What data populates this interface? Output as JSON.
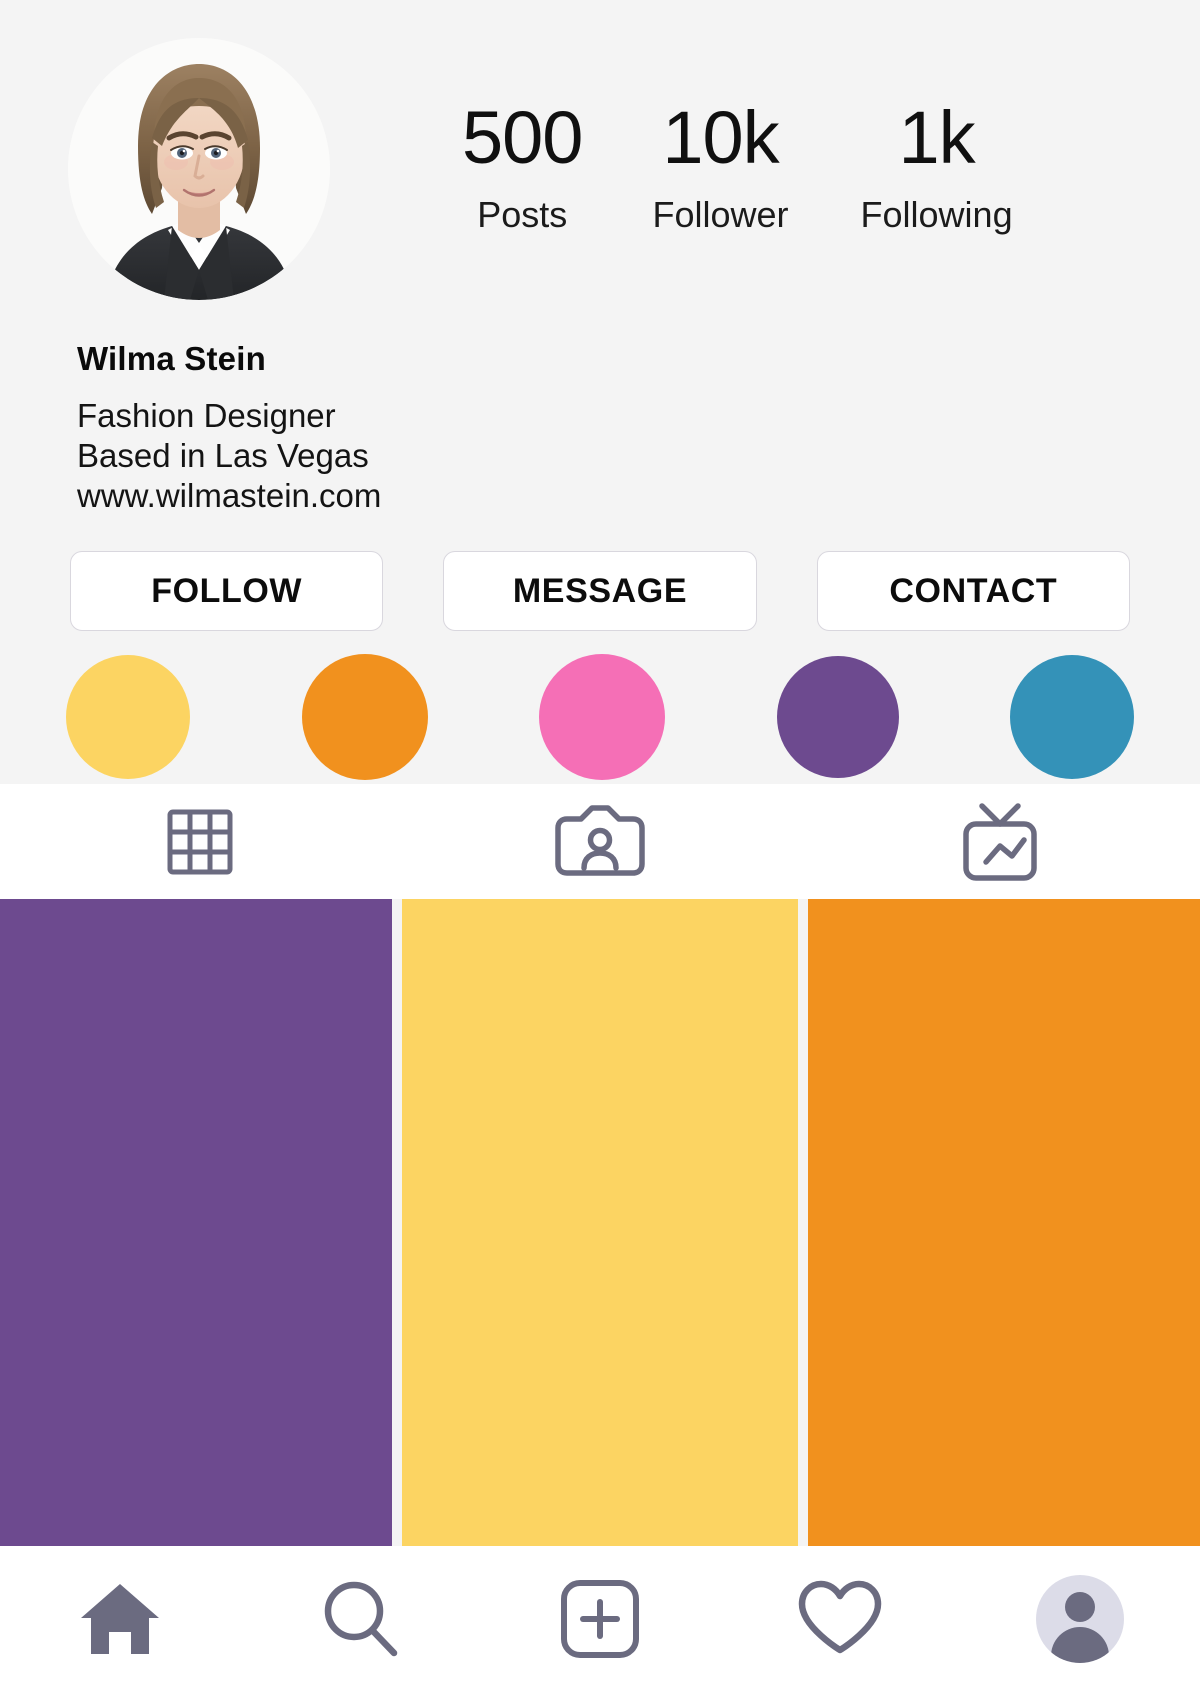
{
  "profile": {
    "avatar_alt": "profile-photo",
    "name": "Wilma Stein",
    "bio_lines": [
      "Fashion Designer",
      "Based in Las Vegas",
      "www.wilmastein.com"
    ],
    "stats": [
      {
        "value": "500",
        "label": "Posts"
      },
      {
        "value": "10k",
        "label": "Follower"
      },
      {
        "value": "1k",
        "label": "Following"
      }
    ],
    "actions": [
      {
        "label": "FOLLOW"
      },
      {
        "label": "MESSAGE"
      },
      {
        "label": "CONTACT"
      }
    ],
    "highlights": [
      {
        "name": "highlight-yellow",
        "color": "#fcd462",
        "size": 124
      },
      {
        "name": "highlight-orange",
        "color": "#f1911e",
        "size": 126
      },
      {
        "name": "highlight-pink",
        "color": "#f56fb6",
        "size": 126
      },
      {
        "name": "highlight-purple",
        "color": "#6d4a8f",
        "size": 122
      },
      {
        "name": "highlight-blue",
        "color": "#3492b8",
        "size": 124
      }
    ]
  },
  "tabs": [
    {
      "icon": "grid-icon",
      "label": "Posts grid"
    },
    {
      "icon": "tagged-icon",
      "label": "Tagged"
    },
    {
      "icon": "igtv-icon",
      "label": "IGTV"
    }
  ],
  "grid_cells": [
    {
      "color": "#6d4a8f",
      "name": "post-thumbnail-purple"
    },
    {
      "color": "#fcd462",
      "name": "post-thumbnail-yellow"
    },
    {
      "color": "#f1911e",
      "name": "post-thumbnail-orange"
    }
  ],
  "bottom_nav": [
    {
      "icon": "home-icon",
      "label": "Home"
    },
    {
      "icon": "search-icon",
      "label": "Search"
    },
    {
      "icon": "add-post-icon",
      "label": "Create"
    },
    {
      "icon": "heart-icon",
      "label": "Activity"
    },
    {
      "icon": "profile-avatar-icon",
      "label": "Profile"
    }
  ],
  "colors": {
    "background": "#f4f4f4",
    "surface": "#ffffff",
    "icon_stroke": "#6b6b80",
    "text": "#101010",
    "border": "#d9d7de"
  }
}
